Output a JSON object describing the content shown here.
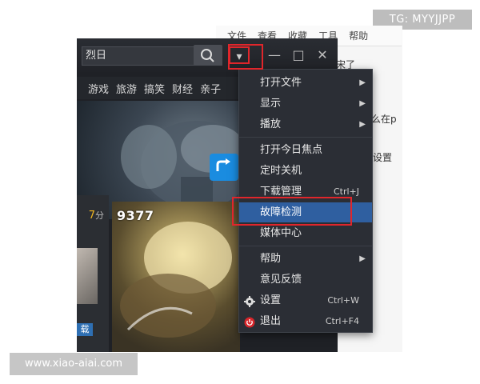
{
  "watermarks": {
    "top": "TG: MYYJJPP",
    "bottom": "www.xiao-aiai.com"
  },
  "background_browser": {
    "menu": [
      "文件",
      "查看",
      "收藏",
      "工具",
      "帮助"
    ],
    "snippet_1": "宋了",
    "snippet_2": "多么在p",
    "settings": "设置"
  },
  "player": {
    "search_value": "烈日",
    "categories": [
      "游戏",
      "旅游",
      "搞笑",
      "财经",
      "亲子"
    ],
    "score": "7",
    "score_unit": "分",
    "game_logo": "9377",
    "left_button": "载",
    "window_controls": {
      "menu": "▾",
      "minimize": "—",
      "maximize": "□",
      "close": "✕"
    }
  },
  "menu": {
    "items": [
      {
        "label": "打开文件",
        "submenu": true
      },
      {
        "label": "显示",
        "submenu": true
      },
      {
        "label": "播放",
        "submenu": true
      },
      {
        "label": "打开今日焦点"
      },
      {
        "label": "定时关机"
      },
      {
        "label": "下载管理",
        "shortcut": "Ctrl+J"
      },
      {
        "label": "故障检测",
        "selected": true
      },
      {
        "label": "媒体中心"
      },
      {
        "label": "帮助",
        "submenu": true
      },
      {
        "label": "意见反馈"
      },
      {
        "label": "设置",
        "shortcut": "Ctrl+W",
        "icon": "gear-icon"
      },
      {
        "label": "退出",
        "shortcut": "Ctrl+F4",
        "icon": "power-icon"
      }
    ]
  },
  "colors": {
    "highlight_box": "#e0262b",
    "menu_selected": "#2f5fa0",
    "menu_bg": "#2b2e35",
    "score": "#f2b620"
  }
}
